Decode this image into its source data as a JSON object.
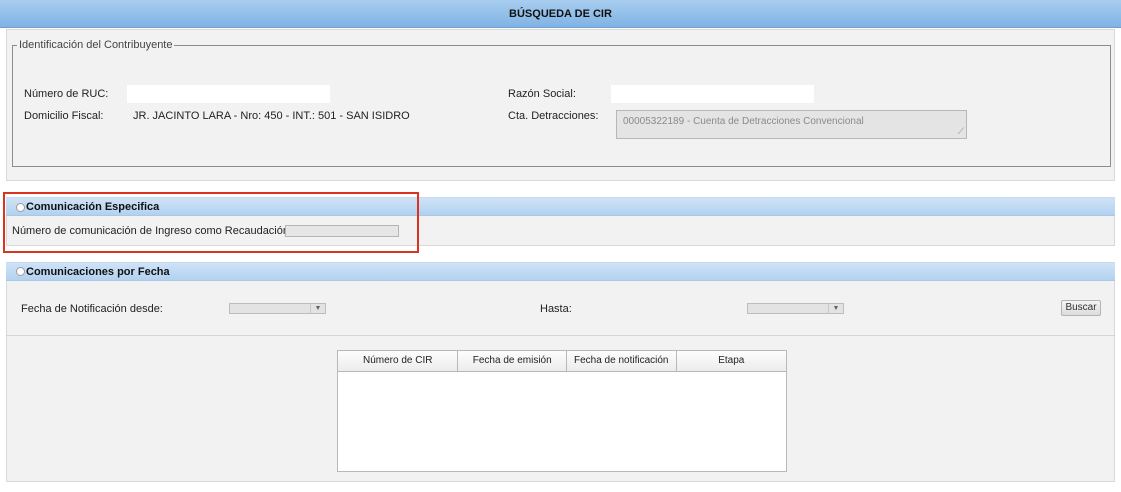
{
  "window": {
    "title": "BÚSQUEDA DE CIR"
  },
  "identificacion": {
    "legend": "Identificación del Contribuyente",
    "ruc_label": "Número de RUC:",
    "ruc_value": "",
    "razon_label": "Razón Social:",
    "razon_value": "",
    "domicilio_label": "Domicilio Fiscal:",
    "domicilio_value": "JR. JACINTO LARA - Nro: 450 - INT.: 501 - SAN ISIDRO",
    "cta_label": "Cta. Detracciones:",
    "cta_value": "00005322189 - Cuenta de Detracciones Convencional"
  },
  "comunicacion_especifica": {
    "title": "Comunicación Especifica",
    "cir_label": "Número de comunicación de Ingreso como Recaudación (CIR):",
    "cir_value": ""
  },
  "comunicaciones_fecha": {
    "title": "Comunicaciones por Fecha",
    "desde_label": "Fecha de Notificación desde:",
    "desde_value": "",
    "hasta_label": "Hasta:",
    "hasta_value": "",
    "buscar_label": "Buscar"
  },
  "results_table": {
    "columns": [
      "Número de CIR",
      "Fecha de emisión",
      "Fecha de notificación",
      "Etapa"
    ],
    "rows": []
  },
  "icons": {
    "dropdown_arrow": "▼",
    "resize_grip": "⟋"
  },
  "colors": {
    "header_blue": "#8fbde9",
    "section_blue": "#bfd9f3",
    "highlight_red": "#d9341f"
  }
}
